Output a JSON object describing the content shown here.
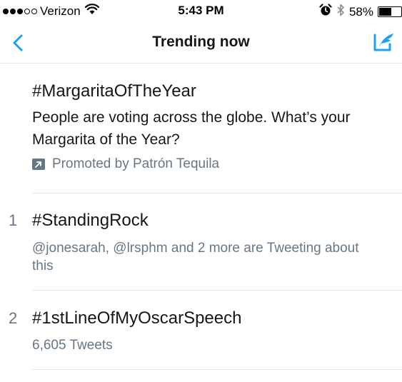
{
  "status_bar": {
    "carrier": "Verizon",
    "time": "5:43 PM",
    "battery": "58%",
    "battery_level": 0.58,
    "icons": [
      "signal-dots",
      "wifi-icon",
      "alarm-icon",
      "bluetooth-icon",
      "battery-icon"
    ]
  },
  "nav": {
    "title": "Trending now",
    "back_icon": "chevron-left-icon",
    "compose_icon": "compose-tweet-icon",
    "accent_color": "#1da1f2"
  },
  "trends": [
    {
      "rank": "",
      "name": "#MargaritaOfTheYear",
      "description": "People are voting across the globe. What’s your Margarita of the Year?",
      "promoted": "Promoted by Patrón Tequila"
    },
    {
      "rank": "1",
      "name": "#StandingRock",
      "meta": "@jonesarah, @lrsphm and 2 more are Tweeting about this"
    },
    {
      "rank": "2",
      "name": "#1stLineOfMyOscarSpeech",
      "meta": "6,605 Tweets"
    }
  ]
}
